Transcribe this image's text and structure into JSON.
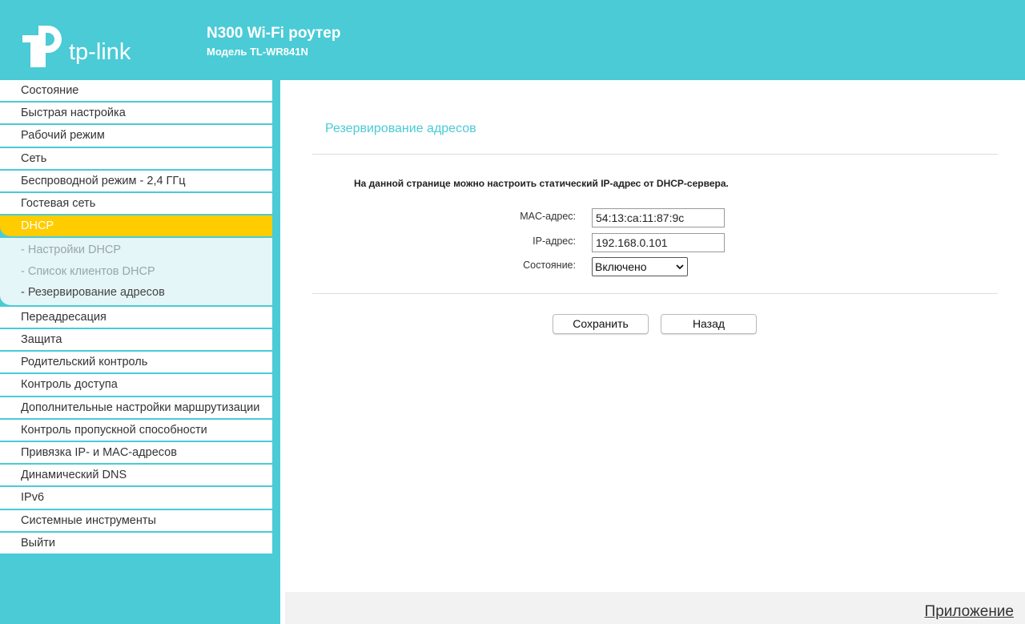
{
  "header": {
    "logo_text": "tp-link",
    "model_title": "N300 Wi-Fi роутер",
    "model_subtitle": "Модель TL-WR841N"
  },
  "sidebar": {
    "items_top": [
      {
        "label": "Состояние"
      },
      {
        "label": "Быстрая настройка"
      },
      {
        "label": "Рабочий режим"
      },
      {
        "label": "Сеть"
      },
      {
        "label": "Беспроводной режим - 2,4 ГГц"
      },
      {
        "label": "Гостевая сеть"
      }
    ],
    "active": {
      "label": "DHCP"
    },
    "subitems": [
      {
        "label": "- Настройки DHCP"
      },
      {
        "label": "- Список клиентов DHCP"
      },
      {
        "label": "- Резервирование адресов"
      }
    ],
    "items_bottom": [
      {
        "label": "Переадресация"
      },
      {
        "label": "Защита"
      },
      {
        "label": "Родительский контроль"
      },
      {
        "label": "Контроль доступа"
      },
      {
        "label": "Дополнительные настройки маршрутизации"
      },
      {
        "label": "Контроль пропускной способности"
      },
      {
        "label": "Привязка IP- и MAC-адресов"
      },
      {
        "label": "Динамический DNS"
      },
      {
        "label": "IPv6"
      },
      {
        "label": "Системные инструменты"
      },
      {
        "label": "Выйти"
      }
    ]
  },
  "main": {
    "title": "Резервирование адресов",
    "description": "На данной странице можно настроить статический IP-адрес от DHCP-сервера.",
    "mac_label": "MAC-адрес:",
    "mac_value": "54:13:ca:11:87:9c",
    "ip_label": "IP-адрес:",
    "ip_value": "192.168.0.101",
    "status_label": "Состояние:",
    "status_value": "Включено",
    "save_label": "Сохранить",
    "back_label": "Назад"
  },
  "footer": {
    "link": "Приложение"
  },
  "colors": {
    "accent": "#4acbd6",
    "active": "#ffcc00"
  }
}
